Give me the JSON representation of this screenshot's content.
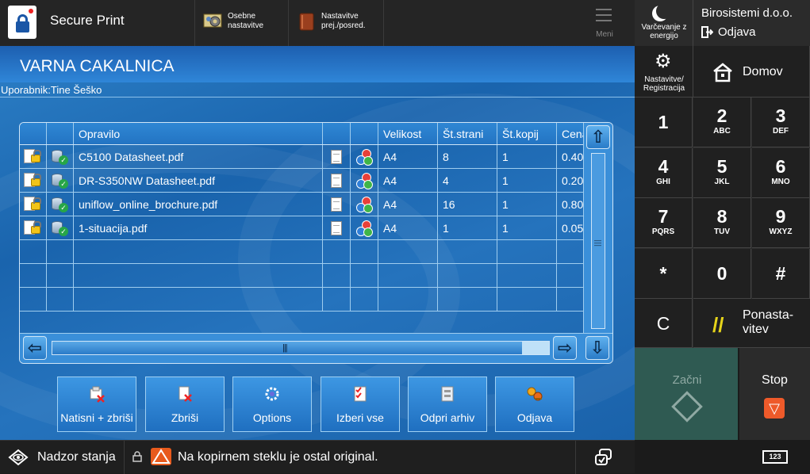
{
  "topbar": {
    "app_title": "Secure Print",
    "favorites": [
      {
        "label": "Osebne nastavitve"
      },
      {
        "label": "Nastavitve prej./posred."
      }
    ],
    "menu_label": "Meni"
  },
  "side": {
    "energy_label": "Varčevanje z energijo",
    "company": "Birosistemi d.o.o.",
    "logout_label": "Odjava",
    "settings_label": "Nastavitve/ Registracija",
    "home_label": "Domov",
    "keys": [
      {
        "k": "1",
        "s": ""
      },
      {
        "k": "2",
        "s": "ABC"
      },
      {
        "k": "3",
        "s": "DEF"
      },
      {
        "k": "4",
        "s": "GHI"
      },
      {
        "k": "5",
        "s": "JKL"
      },
      {
        "k": "6",
        "s": "MNO"
      },
      {
        "k": "7",
        "s": "PQRS"
      },
      {
        "k": "8",
        "s": "TUV"
      },
      {
        "k": "9",
        "s": "WXYZ"
      },
      {
        "k": "*",
        "s": ""
      },
      {
        "k": "0",
        "s": ""
      },
      {
        "k": "#",
        "s": ""
      }
    ],
    "clear_label": "C",
    "reset_label": "Ponasta- vitev",
    "start_label": "Začni",
    "stop_label": "Stop",
    "keyboard_label": "123"
  },
  "main": {
    "title": "VARNA CAKALNICA",
    "user_line": "Uporabnik:Tine Šeško",
    "columns": [
      "",
      "",
      "Opravilo",
      "",
      "",
      "Velikost",
      "Št.strani",
      "Št.kopij",
      "Cena"
    ],
    "jobs": [
      {
        "name": "C5100 Datasheet.pdf",
        "size": "A4",
        "pages": "8",
        "copies": "1",
        "price": "0.40"
      },
      {
        "name": "DR-S350NW Datasheet.pdf",
        "size": "A4",
        "pages": "4",
        "copies": "1",
        "price": "0.20"
      },
      {
        "name": "uniflow_online_brochure.pdf",
        "size": "A4",
        "pages": "16",
        "copies": "1",
        "price": "0.80"
      },
      {
        "name": "1-situacija.pdf",
        "size": "A4",
        "pages": "1",
        "copies": "1",
        "price": "0.05"
      }
    ],
    "actions": [
      {
        "label": "Natisni + zbriši",
        "icon": "print-delete-icon"
      },
      {
        "label": "Zbriši",
        "icon": "delete-icon"
      },
      {
        "label": "Options",
        "icon": "options-icon"
      },
      {
        "label": "Izberi vse",
        "icon": "select-all-icon"
      },
      {
        "label": "Odpri arhiv",
        "icon": "archive-icon"
      },
      {
        "label": "Odjava",
        "icon": "logout-keys-icon"
      }
    ]
  },
  "status": {
    "monitor_label": "Nadzor stanja",
    "message": "Na kopirnem steklu je ostal original."
  },
  "colors": {
    "accent_blue": "#2374c3",
    "warning": "#e85a1c",
    "stop": "#ee5a2a",
    "start_bg": "#2f5a52",
    "reset_slash": "#e6d41a"
  }
}
